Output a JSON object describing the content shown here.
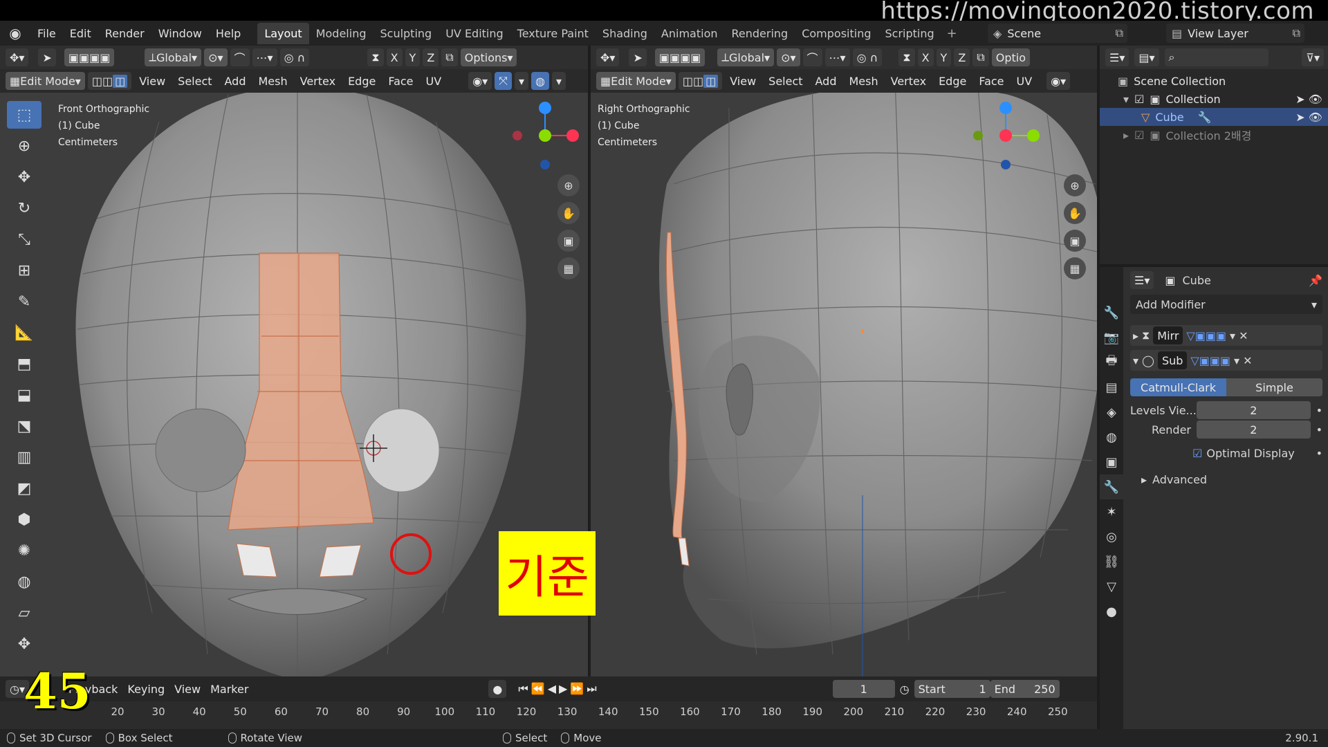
{
  "watermark": "https://movingtoon2020.tistory.com",
  "menu": [
    "File",
    "Edit",
    "Render",
    "Window",
    "Help"
  ],
  "workspaces": [
    "Layout",
    "Modeling",
    "Sculpting",
    "UV Editing",
    "Texture Paint",
    "Shading",
    "Animation",
    "Rendering",
    "Compositing",
    "Scripting"
  ],
  "active_workspace": "Layout",
  "scene": "Scene",
  "view_layer": "View Layer",
  "viewport_left": {
    "transform": "Global",
    "options": "Options",
    "axes": [
      "X",
      "Y",
      "Z"
    ],
    "mode": "Edit Mode",
    "menus": [
      "View",
      "Select",
      "Add",
      "Mesh",
      "Vertex",
      "Edge",
      "Face",
      "UV"
    ],
    "info": [
      "Front Orthographic",
      "(1) Cube",
      "Centimeters"
    ]
  },
  "viewport_right": {
    "transform": "Global",
    "options": "Optio",
    "axes": [
      "X",
      "Y",
      "Z"
    ],
    "mode": "Edit Mode",
    "menus": [
      "View",
      "Select",
      "Add",
      "Mesh",
      "Vertex",
      "Edge",
      "Face",
      "UV"
    ],
    "info": [
      "Right Orthographic",
      "(1) Cube",
      "Centimeters"
    ]
  },
  "ref_label": "기준",
  "outliner": {
    "scene_collection": "Scene Collection",
    "items": [
      "Collection",
      "Cube",
      "Collection 2배경"
    ]
  },
  "properties": {
    "object_name": "Cube",
    "add_modifier": "Add Modifier",
    "modifier1": "Mirr",
    "modifier2": "Sub",
    "catmull": "Catmull-Clark",
    "simple": "Simple",
    "levels_label": "Levels Vie...",
    "levels_value": "2",
    "render_label": "Render",
    "render_value": "2",
    "optimal": "Optimal Display",
    "advanced": "Advanced"
  },
  "timeline": {
    "playback": "Playback",
    "keying": "Keying",
    "view": "View",
    "marker": "Marker",
    "current_frame": "1",
    "start_label": "Start",
    "start": "1",
    "end_label": "End",
    "end": "250",
    "ticks": [
      "20",
      "30",
      "40",
      "50",
      "60",
      "70",
      "80",
      "90",
      "100",
      "110",
      "120",
      "130",
      "140",
      "150",
      "160",
      "170",
      "180",
      "190",
      "200",
      "210",
      "220",
      "230",
      "240",
      "250"
    ]
  },
  "frame_overlay": "45",
  "status": {
    "left1": "Set 3D Cursor",
    "left2": "Box Select",
    "left3": "Rotate View",
    "mid1": "Select",
    "mid2": "Move",
    "version": "2.90.1"
  }
}
